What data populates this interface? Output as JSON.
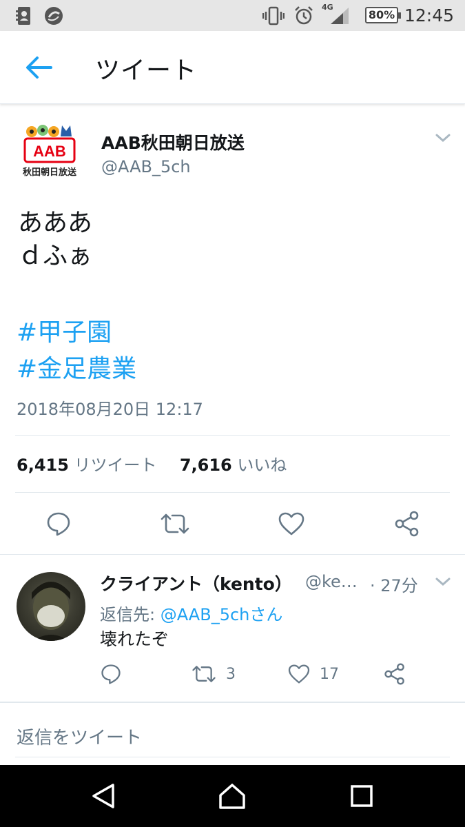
{
  "status_bar": {
    "time": "12:45",
    "battery": "80%",
    "network": "4G",
    "icons": [
      "contacts-icon",
      "sync-icon",
      "vibrate-icon",
      "alarm-icon",
      "signal-icon",
      "battery-icon"
    ]
  },
  "app_bar": {
    "title": "ツイート",
    "back_icon": "arrow-left-icon"
  },
  "tweet": {
    "author_name": "AAB秋田朝日放送",
    "author_handle": "@AAB_5ch",
    "avatar_logo_text": "AAB",
    "avatar_caption": "秋田朝日放送",
    "body_lines": [
      "あああ",
      "ｄふぁ"
    ],
    "hashtags": [
      "#甲子園",
      "#金足農業"
    ],
    "timestamp": "2018年08月20日 12:17",
    "retweet_count": "6,415",
    "retweet_label": "リツイート",
    "like_count": "7,616",
    "like_label": "いいね",
    "actions": [
      "reply-icon",
      "retweet-icon",
      "like-icon",
      "share-icon"
    ]
  },
  "reply": {
    "author_name": "クライアント（kento）",
    "author_handle": "@ke…",
    "time": "· 27分",
    "reply_to_prefix": "返信先: ",
    "reply_to_user": "@AAB_5chさん",
    "text": "壊れたぞ",
    "retweet_count": "3",
    "like_count": "17"
  },
  "compose": {
    "placeholder": "返信をツイート"
  },
  "colors": {
    "accent": "#1da1f2",
    "secondary_text": "#657786",
    "primary_text": "#14171a",
    "divider": "#e1e8ed",
    "status_bar_bg": "#e6e6e6",
    "nav_bar_bg": "#000000",
    "logo_red": "#e60012"
  }
}
